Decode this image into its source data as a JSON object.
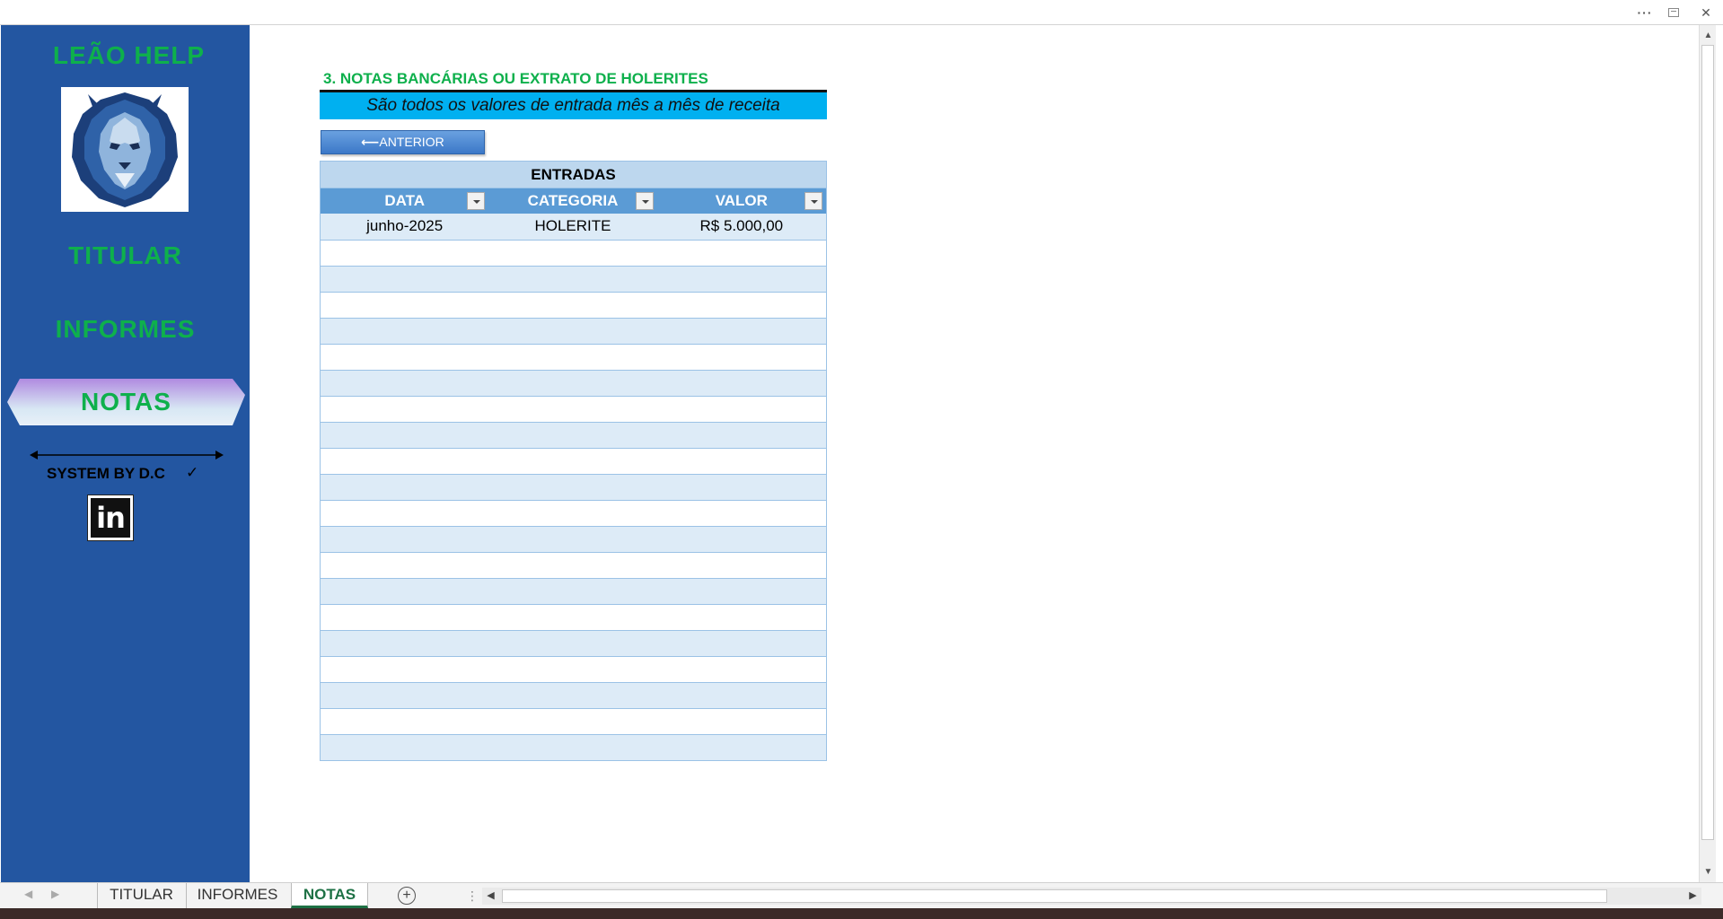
{
  "window": {
    "more_label": "···",
    "close_label": "✕"
  },
  "sidebar": {
    "brand": "LEÃO HELP",
    "nav": {
      "titular": "TITULAR",
      "informes": "INFORMES",
      "notas": "NOTAS"
    },
    "credit": "SYSTEM BY D.C",
    "credit_icon": "check-icon",
    "social": {
      "icon": "linkedin-icon",
      "label": "in"
    }
  },
  "main": {
    "section_title": "3. NOTAS BANCÁRIAS OU EXTRATO DE HOLERITES",
    "subtitle": "São todos os valores de entrada mês a mês de receita",
    "back_button": {
      "arrow": "⟵",
      "label": "ANTERIOR"
    },
    "table": {
      "caption": "ENTRADAS",
      "columns": [
        "DATA",
        "CATEGORIA",
        "VALOR"
      ],
      "rows": [
        [
          "junho-2025",
          "HOLERITE",
          "R$ 5.000,00"
        ],
        [
          "",
          "",
          ""
        ],
        [
          "",
          "",
          ""
        ],
        [
          "",
          "",
          ""
        ],
        [
          "",
          "",
          ""
        ],
        [
          "",
          "",
          ""
        ],
        [
          "",
          "",
          ""
        ],
        [
          "",
          "",
          ""
        ],
        [
          "",
          "",
          ""
        ],
        [
          "",
          "",
          ""
        ],
        [
          "",
          "",
          ""
        ],
        [
          "",
          "",
          ""
        ],
        [
          "",
          "",
          ""
        ],
        [
          "",
          "",
          ""
        ],
        [
          "",
          "",
          ""
        ],
        [
          "",
          "",
          ""
        ],
        [
          "",
          "",
          ""
        ],
        [
          "",
          "",
          ""
        ],
        [
          "",
          "",
          ""
        ],
        [
          "",
          "",
          ""
        ],
        [
          "",
          "",
          ""
        ]
      ]
    }
  },
  "tabs": {
    "sheets": [
      "TITULAR",
      "INFORMES",
      "NOTAS"
    ],
    "active": "NOTAS",
    "add_label": "+"
  },
  "colors": {
    "sidebar_bg": "#2356a1",
    "brand_green": "#0eb04c",
    "subtitle_bg": "#00b0f0",
    "table_header": "#5b9bd5",
    "table_band": "#ddebf7"
  }
}
